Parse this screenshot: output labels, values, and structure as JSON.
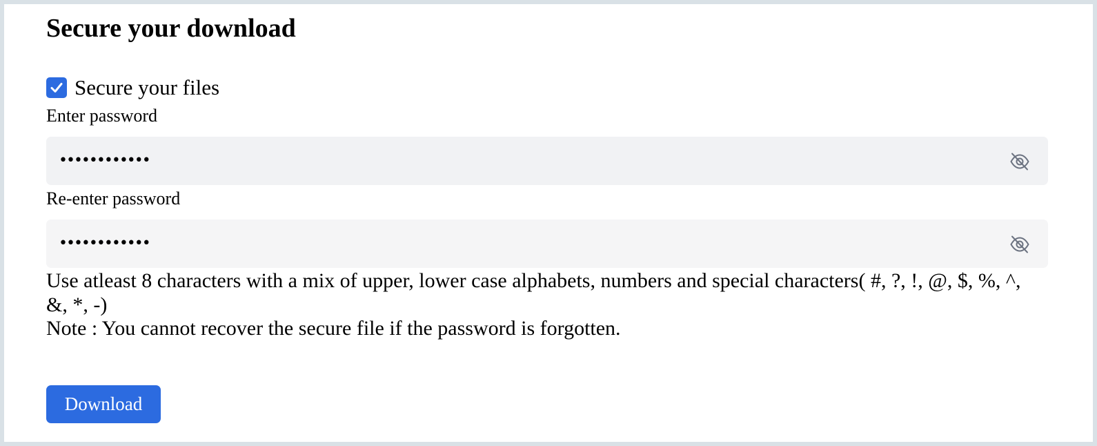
{
  "page": {
    "title": "Secure your download"
  },
  "secure_option": {
    "label": "Secure your files",
    "checked": true
  },
  "password": {
    "label": "Enter password",
    "masked_value": "••••••••••••",
    "toggle_icon": "eye-slash-icon"
  },
  "confirm_password": {
    "label": "Re-enter password",
    "masked_value": "••••••••••••",
    "toggle_icon": "eye-slash-icon"
  },
  "hint_text": "Use atleast 8 characters with a mix of upper, lower case alphabets, numbers and special characters( #, ?, !, @, $, %, ^, &, *, -)",
  "note_text": "Note : You cannot recover the secure file if the password is forgotten.",
  "download_button": {
    "label": "Download"
  },
  "colors": {
    "accent": "#2c6be0",
    "page_border": "#d9e1e6",
    "field_background": "#f1f2f4",
    "icon": "#6b7280"
  }
}
